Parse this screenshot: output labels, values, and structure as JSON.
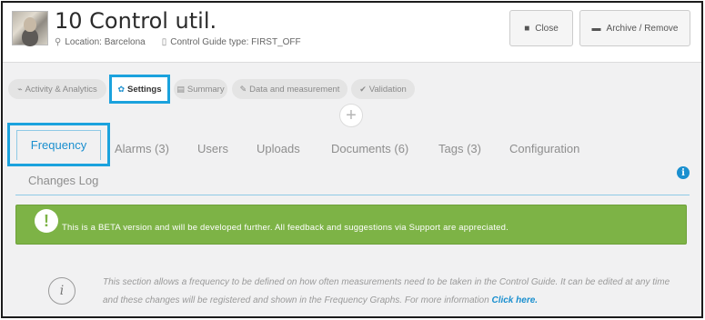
{
  "header": {
    "title": "10 Control util.",
    "location_label": "Location: Barcelona",
    "guide_type_label": "Control Guide type: FIRST_OFF",
    "close_label": "Close",
    "archive_label": "Archive / Remove"
  },
  "pills": {
    "activity": "Activity & Analytics",
    "settings": "Settings",
    "summary": "Summary",
    "data": "Data and measurement",
    "validation": "Validation"
  },
  "tabs": {
    "frequency": "Frequency",
    "alarms": "Alarms (3)",
    "users": "Users",
    "uploads": "Uploads",
    "documents": "Documents (6)",
    "tags": "Tags (3)",
    "configuration": "Configuration",
    "changes_log": "Changes Log"
  },
  "banner": {
    "message": "This is a BETA version and will be developed further. All feedback and suggestions via Support are appreciated."
  },
  "info": {
    "text": "This section allows a frequency to be defined on how often measurements need to be taken in the Control Guide. It can be edited at any time and these changes will be registered and shown in the Frequency Graphs. For more information",
    "link": "Click here."
  },
  "colors": {
    "accent": "#1a8fcf",
    "highlight": "#1ba2dd",
    "banner": "#7db346"
  },
  "icons": [
    "location-pin-icon",
    "document-icon",
    "folder-icon",
    "archive-icon",
    "chart-icon",
    "gear-icon",
    "summary-icon",
    "pencil-icon",
    "check-icon",
    "plus-icon",
    "info-icon",
    "exclamation-icon"
  ]
}
